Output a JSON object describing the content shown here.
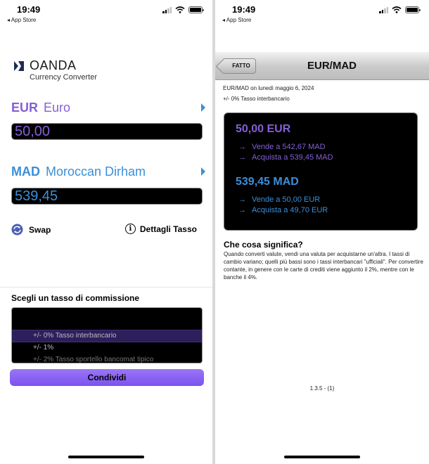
{
  "status": {
    "time": "19:49",
    "back_label": "◂ App Store"
  },
  "converter": {
    "brand": "OANDA",
    "brand_sub": "Currency Converter",
    "from": {
      "code": "EUR",
      "name": "Euro",
      "amount": "50,00",
      "color": "#8460d6"
    },
    "to": {
      "code": "MAD",
      "name": "Moroccan Dirham",
      "amount": "539,45",
      "color": "#3b8fd9"
    },
    "swap_label": "Swap",
    "details_label": "Dettagli Tasso",
    "commission_title": "Scegli un tasso di commissione",
    "commission_options": [
      "+/- 0% Tasso interbancario",
      "+/- 1%",
      "+/- 2% Tasso sportello bancomat tipico"
    ],
    "selected_option": "+/- 0% Tasso interbancario",
    "share_label": "Condividi"
  },
  "detail": {
    "back_button": "FATTO",
    "title": "EUR/MAD",
    "date_line": "EUR/MAD on lunedì maggio 6, 2024",
    "rate_type": "+/- 0% Tasso interbancario",
    "from_amount": "50,00  EUR",
    "from_sell": "Vende a 542,67  MAD",
    "from_buy": "Acquista a 539,45  MAD",
    "to_amount": "539,45  MAD",
    "to_sell": "Vende a 50,00  EUR",
    "to_buy": "Acquista a 49,70  EUR",
    "meaning_title": "Che cosa significa?",
    "meaning_text": "Quando converti valute, vendi una valuta per acquistarne un'altra. I tassi di cambio variano; quelli più bassi sono i tassi interbancari \"ufficiali\". Per convertire contante, in genere con le carte di crediti viene aggiunto il 2%, mentre con le banche il 4%.",
    "version": "1.3.5 - (1)"
  },
  "colors": {
    "purple": "#8460d6",
    "blue": "#3b8fd9",
    "share_button": "#8b63f3"
  },
  "icons": [
    "signal-icon",
    "wifi-icon",
    "battery-icon",
    "oanda-logo-icon",
    "swap-icon",
    "info-icon",
    "disclosure-arrow-icon",
    "arrow-right-icon"
  ]
}
